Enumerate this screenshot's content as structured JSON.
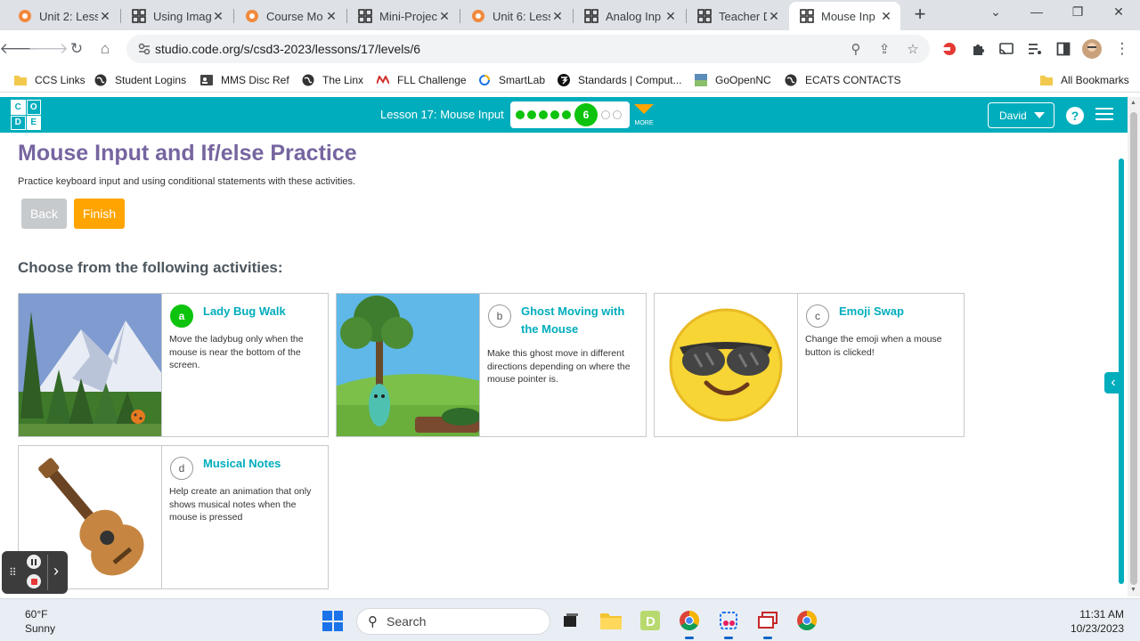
{
  "browser": {
    "tabs": [
      {
        "title": "Unit 2: Less",
        "icon": "code-org-icon"
      },
      {
        "title": "Using Imag",
        "icon": "code-studio-icon"
      },
      {
        "title": "Course Mo",
        "icon": "code-org-icon"
      },
      {
        "title": "Mini-Projec",
        "icon": "code-studio-icon"
      },
      {
        "title": "Unit 6: Less",
        "icon": "code-org-icon"
      },
      {
        "title": "Analog Inp",
        "icon": "code-studio-icon"
      },
      {
        "title": "Teacher Da",
        "icon": "code-studio-icon"
      },
      {
        "title": "Mouse Inp",
        "icon": "code-studio-icon",
        "active": true
      }
    ],
    "url": "studio.code.org/s/csd3-2023/lessons/17/levels/6",
    "bookmarks": [
      {
        "label": "CCS Links",
        "icon": "folder-icon"
      },
      {
        "label": "Student Logins",
        "icon": "globe-icon"
      },
      {
        "label": "MMS Disc Ref",
        "icon": "id-card-icon"
      },
      {
        "label": "The Linx",
        "icon": "globe-icon"
      },
      {
        "label": "FLL Challenge",
        "icon": "fll-icon"
      },
      {
        "label": "SmartLab",
        "icon": "smartlab-icon"
      },
      {
        "label": "Standards | Comput...",
        "icon": "standards-icon"
      },
      {
        "label": "GoOpenNC",
        "icon": "goopennc-icon"
      },
      {
        "label": "ECATS CONTACTS",
        "icon": "globe-icon"
      }
    ],
    "all_bookmarks_label": "All Bookmarks"
  },
  "header": {
    "logo_letters": [
      "C",
      "O",
      "D",
      "E"
    ],
    "lesson_title": "Lesson 17: Mouse Input",
    "progress": {
      "completed": 5,
      "current": "6",
      "remaining": 2
    },
    "more_label": "MORE",
    "user_name": "David",
    "help_label": "?"
  },
  "main": {
    "title": "Mouse Input and If/else Practice",
    "intro": "Practice keyboard input and using conditional statements with these activities.",
    "back_label": "Back",
    "finish_label": "Finish",
    "choose_heading": "Choose from the following activities:",
    "activities": [
      {
        "letter": "a",
        "title": "Lady Bug Walk",
        "description": "Move the ladybug only when the mouse is near the bottom of the screen.",
        "selected": true
      },
      {
        "letter": "b",
        "title": "Ghost Moving with the Mouse",
        "description": "Make this ghost move in different directions depending on where the mouse pointer is.",
        "selected": false
      },
      {
        "letter": "c",
        "title": "Emoji Swap",
        "description": "Change the emoji when a mouse button is clicked!",
        "selected": false
      },
      {
        "letter": "d",
        "title": "Musical Notes",
        "description": "Help create an animation that only shows musical notes when the mouse is pressed",
        "selected": false
      }
    ]
  },
  "taskbar": {
    "weather_temp": "60°F",
    "weather_desc": "Sunny",
    "search_placeholder": "Search",
    "time": "11:31 AM",
    "date": "10/23/2023"
  },
  "colors": {
    "code_teal": "#00adbc",
    "title_purple": "#7665a0",
    "finish_orange": "#ffa400",
    "progress_green": "#0ec30e"
  }
}
